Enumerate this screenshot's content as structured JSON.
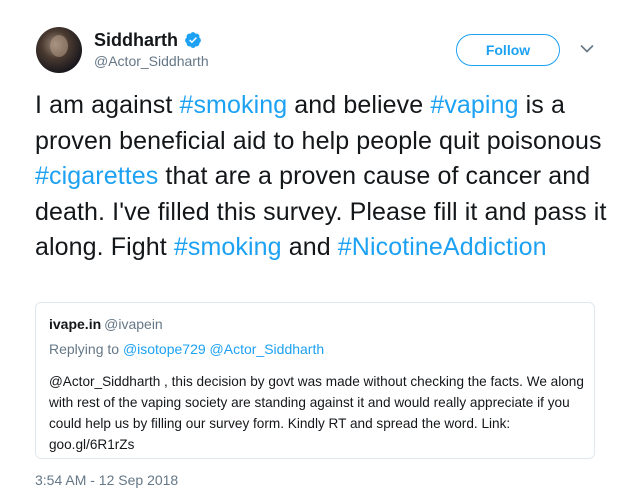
{
  "author": {
    "display_name": "Siddharth",
    "handle": "@Actor_Siddharth",
    "verified": true
  },
  "follow_button": {
    "label": "Follow"
  },
  "tweet": {
    "segments": [
      {
        "text": "I am against ",
        "hashtag": false
      },
      {
        "text": "#smoking",
        "hashtag": true
      },
      {
        "text": " and believe ",
        "hashtag": false
      },
      {
        "text": "#vaping",
        "hashtag": true
      },
      {
        "text": " is a proven beneficial aid to help people quit poisonous ",
        "hashtag": false
      },
      {
        "text": "#cigarettes",
        "hashtag": true
      },
      {
        "text": " that are a proven cause of cancer and death. I've filled this survey. Please fill it and pass it along. Fight ",
        "hashtag": false
      },
      {
        "text": "#smoking",
        "hashtag": true
      },
      {
        "text": " and ",
        "hashtag": false
      },
      {
        "text": "#NicotineAddiction",
        "hashtag": true
      }
    ]
  },
  "quoted_tweet": {
    "name": "ivape.in",
    "handle": "@ivapein",
    "replying_prefix": "Replying to",
    "replying_to": "@isotope729 @Actor_Siddharth",
    "body": "@Actor_Siddharth , this decision by govt was made without checking the facts. We along with rest of the vaping society are standing against it and would really appreciate if you could help us by filling our survey form. Kindly RT and spread the word. Link: goo.gl/6R1rZs"
  },
  "timestamp": "3:54 AM - 12 Sep 2018",
  "colors": {
    "accent": "#1da1f2",
    "secondary_text": "#657786",
    "border": "#e1e8ed"
  }
}
